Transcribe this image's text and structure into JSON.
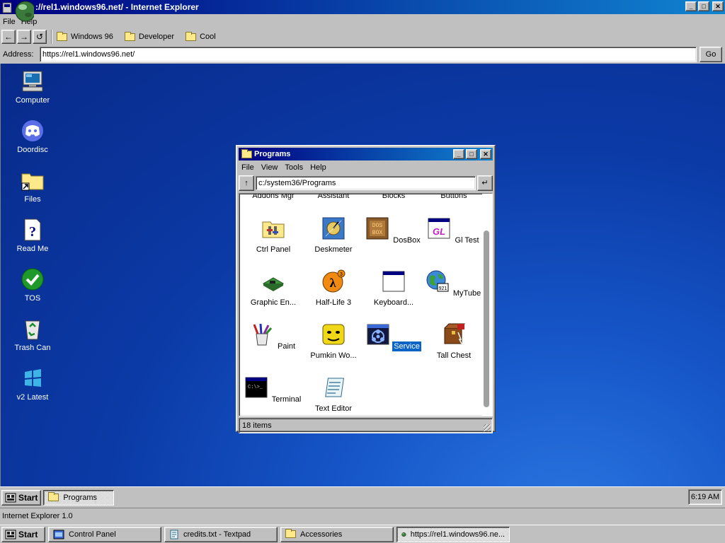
{
  "ie": {
    "title": "://rel1.windows96.net/ - Internet Explorer",
    "menu": [
      "File",
      "Help"
    ],
    "controls": {
      "minimize": "_",
      "maximize": "□",
      "close": "✕"
    },
    "nav": {
      "back": "←",
      "forward": "→",
      "refresh": "↺"
    },
    "favorites": [
      "Windows 96",
      "Developer",
      "Cool"
    ],
    "address_label": "Address:",
    "address_value": "https://rel1.windows96.net/",
    "go_label": "Go",
    "status": "Internet Explorer 1.0"
  },
  "desktop": {
    "icons": [
      {
        "label": "Computer",
        "icon": "computer-icon"
      },
      {
        "label": "Doordisc",
        "icon": "discord-icon"
      },
      {
        "label": "Files",
        "icon": "folder-shortcut-icon"
      },
      {
        "label": "Read Me",
        "icon": "help-document-icon"
      },
      {
        "label": "TOS",
        "icon": "checkmark-icon"
      },
      {
        "label": "Trash Can",
        "icon": "recycle-bin-icon"
      },
      {
        "label": "v2 Latest",
        "icon": "windows-flag-icon"
      }
    ]
  },
  "programs_window": {
    "title": "Programs",
    "menu": [
      "File",
      "View",
      "Tools",
      "Help"
    ],
    "path": "c:/system36/Programs",
    "up_label": "↑",
    "go_label": "↵",
    "top_row_partial": [
      "Addons Mgr",
      "Assistant",
      "Blocks",
      "Buttons"
    ],
    "items": [
      {
        "label": "Ctrl Panel",
        "icon": "control-panel-icon"
      },
      {
        "label": "Deskmeter",
        "icon": "deskmeter-icon"
      },
      {
        "label": "DosBox",
        "icon": "dosbox-icon"
      },
      {
        "label": "Gl Test",
        "icon": "gl-test-icon"
      },
      {
        "label": "Graphic En...",
        "icon": "graphics-card-icon"
      },
      {
        "label": "Half-Life 3",
        "icon": "half-life-icon"
      },
      {
        "label": "Keyboard...",
        "icon": "window-icon"
      },
      {
        "label": "MyTube",
        "icon": "globe-icon"
      },
      {
        "label": "Paint",
        "icon": "paint-icon"
      },
      {
        "label": "Pumkin Wo...",
        "icon": "pumpkin-icon"
      },
      {
        "label": "Service",
        "icon": "biohazard-icon"
      },
      {
        "label": "Tall Chest",
        "icon": "chest-icon"
      },
      {
        "label": "Terminal",
        "icon": "terminal-icon"
      },
      {
        "label": "Text Editor",
        "icon": "text-editor-icon"
      }
    ],
    "selected": "Service",
    "status": "18 items"
  },
  "inner_taskbar": {
    "start_label": "Start",
    "tasks": [
      "Programs"
    ],
    "clock": "6:19 AM"
  },
  "outer_taskbar": {
    "start_label": "Start",
    "tasks": [
      "Control Panel",
      "credits.txt - Textpad",
      "Accessories",
      "https://rel1.windows96.ne..."
    ]
  }
}
